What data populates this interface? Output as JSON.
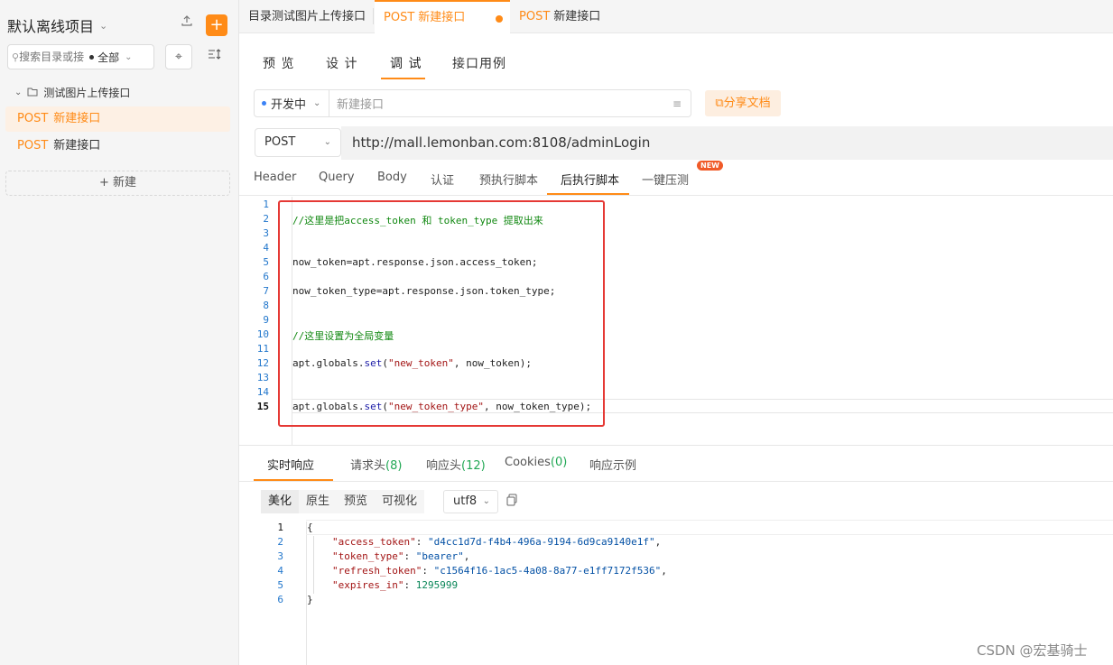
{
  "sidebar": {
    "project_title": "默认离线项目",
    "search_placeholder": "搜索目录或接口",
    "filter_label": "全部",
    "folder_name": "测试图片上传接口",
    "items": [
      {
        "method": "POST",
        "label": "新建接口"
      },
      {
        "method": "POST",
        "label": "新建接口"
      }
    ],
    "new_button": "新建"
  },
  "file_tabs": [
    {
      "label": "目录测试图片上传接口"
    },
    {
      "method": "POST",
      "label": "新建接口"
    },
    {
      "method": "POST",
      "label": "新建接口"
    }
  ],
  "sub_tabs": [
    "预 览",
    "设 计",
    "调 试",
    "接口用例"
  ],
  "env": {
    "selected": "开发中",
    "api_name_placeholder": "新建接口",
    "share_button": "分享文档"
  },
  "request": {
    "method": "POST",
    "url": "http://mall.lemonban.com:8108/adminLogin"
  },
  "request_tabs": [
    "Header",
    "Query",
    "Body",
    "认证",
    "预执行脚本",
    "后执行脚本",
    "一键压测"
  ],
  "new_badge": "NEW",
  "editor": {
    "line_numbers": [
      "1",
      "2",
      "3",
      "4",
      "5",
      "6",
      "7",
      "8",
      "9",
      "10",
      "11",
      "12",
      "13",
      "14",
      "15"
    ],
    "line2_comment": "//这里是把access_token 和 token_type 提取出来",
    "line5": "now_token=apt.response.json.access_token;",
    "line7": "now_token_type=apt.response.json.token_type;",
    "line10_comment": "//这里设置为全局变量",
    "line12": {
      "prefix": "apt.globals.",
      "fn": "set",
      "open": "(",
      "str": "\"new_token\"",
      "rest": ", now_token);"
    },
    "line15": {
      "prefix": "apt.globals.",
      "fn": "set",
      "open": "(",
      "str": "\"new_token_type\"",
      "rest": ", now_token_type);"
    }
  },
  "response_tabs": [
    {
      "label": "实时响应"
    },
    {
      "label": "请求头",
      "count": "(8)"
    },
    {
      "label": "响应头",
      "count": "(12)"
    },
    {
      "label": "Cookies",
      "count": "(0)"
    },
    {
      "label": "响应示例"
    }
  ],
  "format_buttons": [
    "美化",
    "原生",
    "预览",
    "可视化"
  ],
  "encoding": "utf8",
  "response_body": {
    "line_numbers": [
      "1",
      "2",
      "3",
      "4",
      "5",
      "6"
    ],
    "open": "{",
    "fields": [
      {
        "key": "\"access_token\"",
        "value": "\"d4cc1d7d-f4b4-496a-9194-6d9ca9140e1f\"",
        "type": "str",
        "trail": ","
      },
      {
        "key": "\"token_type\"",
        "value": "\"bearer\"",
        "type": "str",
        "trail": ","
      },
      {
        "key": "\"refresh_token\"",
        "value": "\"c1564f16-1ac5-4a08-8a77-e1ff7172f536\"",
        "type": "str",
        "trail": ","
      },
      {
        "key": "\"expires_in\"",
        "value": "1295999",
        "type": "num",
        "trail": ""
      }
    ],
    "close": "}"
  },
  "watermark": "CSDN @宏基骑士",
  "colors": {
    "accent": "#ff8b17",
    "highlight_box": "#e53935"
  }
}
